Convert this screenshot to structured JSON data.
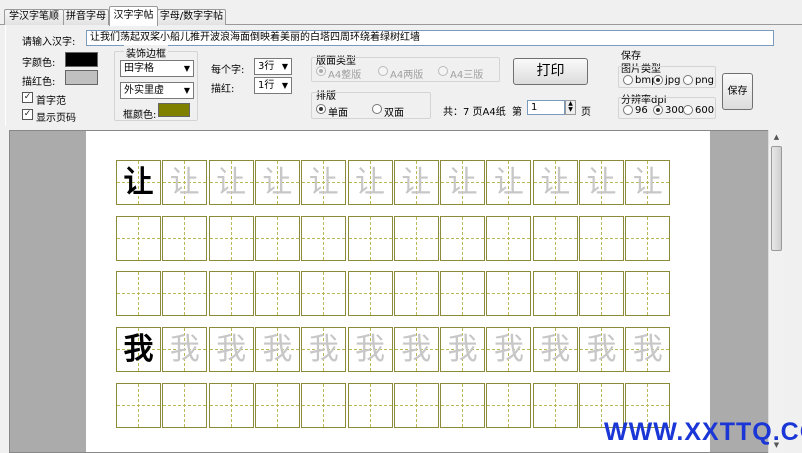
{
  "tabs": [
    {
      "label": "学汉字笔顺"
    },
    {
      "label": "拼音字母"
    },
    {
      "label": "汉字字帖"
    },
    {
      "label": "字母/数字字帖"
    }
  ],
  "input": {
    "label": "请输入汉字:",
    "value": "让我们荡起双桨小船儿推开波浪海面倒映着美丽的白塔四周环绕着绿树红墙"
  },
  "colors": {
    "char_color_label": "字颜色:",
    "char_color": "#000000",
    "trace_color_label": "描红色:",
    "trace_color": "#c0c0c0",
    "frame_color_label": "框颜色:",
    "frame_color": "#808000"
  },
  "options": {
    "first_char": {
      "label": "首字范",
      "checked": true
    },
    "show_page": {
      "label": "显示页码",
      "checked": true
    }
  },
  "border_group": {
    "title": "装饰边框",
    "grid_style": "田字格",
    "line_style": "外实里虚"
  },
  "per_char": {
    "label": "每个字:",
    "value": "3行"
  },
  "trace": {
    "label": "描红:",
    "value": "1行"
  },
  "layout_type": {
    "title": "版面类型",
    "options": [
      {
        "label": "A4整版",
        "selected": true
      },
      {
        "label": "A4两版",
        "selected": false
      },
      {
        "label": "A4三版",
        "selected": false
      }
    ]
  },
  "arrange": {
    "title": "排版",
    "options": [
      {
        "label": "单面",
        "selected": true
      },
      {
        "label": "双面",
        "selected": false
      }
    ]
  },
  "print_label": "打印",
  "pages": {
    "total_text": "共：7 页A4纸",
    "page_prefix": "第",
    "page_value": "1",
    "page_suffix": "页"
  },
  "save_group": {
    "title": "保存",
    "image_type_title": "图片类型",
    "image_types": [
      {
        "label": "bmp",
        "selected": false
      },
      {
        "label": "jpg",
        "selected": true
      },
      {
        "label": "png",
        "selected": false
      }
    ],
    "dpi_title": "分辨率dpi",
    "dpis": [
      {
        "label": "96",
        "selected": false
      },
      {
        "label": "300",
        "selected": true
      },
      {
        "label": "600",
        "selected": false
      }
    ],
    "save_label": "保存"
  },
  "practice": {
    "rows": [
      {
        "char": "让",
        "filled": 12
      },
      {
        "char": "",
        "filled": 0
      },
      {
        "char": "",
        "filled": 0
      },
      {
        "char": "我",
        "filled": 12
      },
      {
        "char": "",
        "filled": 0
      }
    ],
    "columns": 12
  },
  "watermark": "WWW.XXTTQ.COM"
}
